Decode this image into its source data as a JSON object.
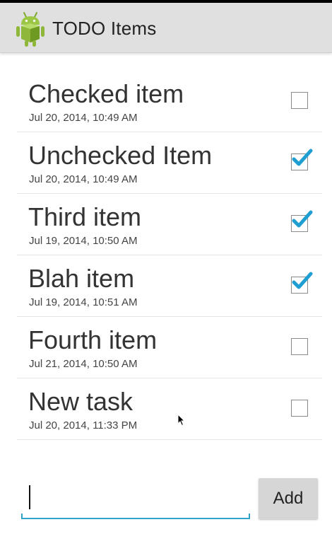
{
  "app": {
    "title": "TODO Items",
    "icon": "android-robot-icon"
  },
  "items": [
    {
      "title": "Checked item",
      "date": "Jul 20, 2014, 10:49 AM",
      "checked": false
    },
    {
      "title": "Unchecked Item",
      "date": "Jul 20, 2014, 10:49 AM",
      "checked": true
    },
    {
      "title": "Third item",
      "date": "Jul 19, 2014, 10:50 AM",
      "checked": true
    },
    {
      "title": "Blah item",
      "date": "Jul 19, 2014, 10:51 AM",
      "checked": true
    },
    {
      "title": "Fourth item",
      "date": "Jul 21, 2014, 10:50 AM",
      "checked": false
    },
    {
      "title": "New task",
      "date": "Jul 20, 2014, 11:33 PM",
      "checked": false
    }
  ],
  "new_item": {
    "value": "",
    "placeholder": "",
    "add_label": "Add"
  },
  "colors": {
    "action_bar": "#e0e0e0",
    "accent": "#33a3c9",
    "android_green": "#8fb83a"
  }
}
